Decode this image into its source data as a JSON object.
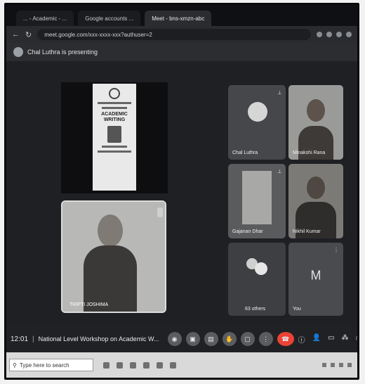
{
  "browser": {
    "tabs": [
      {
        "label": "... - Academic - ...",
        "active": false
      },
      {
        "label": "Google accounts ...",
        "active": false
      },
      {
        "label": "Meet - bns-xmzn-abc",
        "active": true
      }
    ],
    "back_icon": "back-arrow-icon",
    "reload_icon": "reload-icon",
    "url": "meet.google.com/xxx-xxxx-xxx?authuser=2"
  },
  "meet": {
    "presenter_banner": "Chal Luthra is presenting",
    "shared_poster": {
      "title": "ACADEMIC WRITING"
    },
    "speaker": {
      "name": "TRIPTI JOSHIMA"
    },
    "participants": [
      {
        "name": "Chal Luthra",
        "kind": "avatar-photo"
      },
      {
        "name": "Minakshi Rana",
        "kind": "video"
      },
      {
        "name": "Gajanan Dhar",
        "kind": "video"
      },
      {
        "name": "Nikhil Kumar",
        "kind": "video"
      },
      {
        "name": "63 others",
        "kind": "group"
      },
      {
        "name": "You",
        "kind": "letter",
        "letter": "M"
      }
    ],
    "controls": {
      "time": "12:01",
      "separator": "|",
      "meeting_title": "National Level Workshop on Academic W...",
      "buttons": [
        {
          "icon": "mic-icon",
          "glyph": "◉"
        },
        {
          "icon": "camera-icon",
          "glyph": "▣"
        },
        {
          "icon": "captions-icon",
          "glyph": "▤"
        },
        {
          "icon": "raise-hand-icon",
          "glyph": "✋"
        },
        {
          "icon": "present-icon",
          "glyph": "▢"
        },
        {
          "icon": "more-options-icon",
          "glyph": "⋮"
        },
        {
          "icon": "end-call-icon",
          "glyph": "☎"
        }
      ],
      "right": [
        {
          "icon": "info-icon",
          "glyph": "ⓘ"
        },
        {
          "icon": "people-icon",
          "glyph": "👤"
        },
        {
          "icon": "chat-icon",
          "glyph": "▭"
        },
        {
          "icon": "activities-icon",
          "glyph": "⁂"
        },
        {
          "icon": "lock-icon",
          "glyph": "⌂"
        }
      ]
    }
  },
  "taskbar": {
    "search_placeholder": "Type here to search"
  }
}
